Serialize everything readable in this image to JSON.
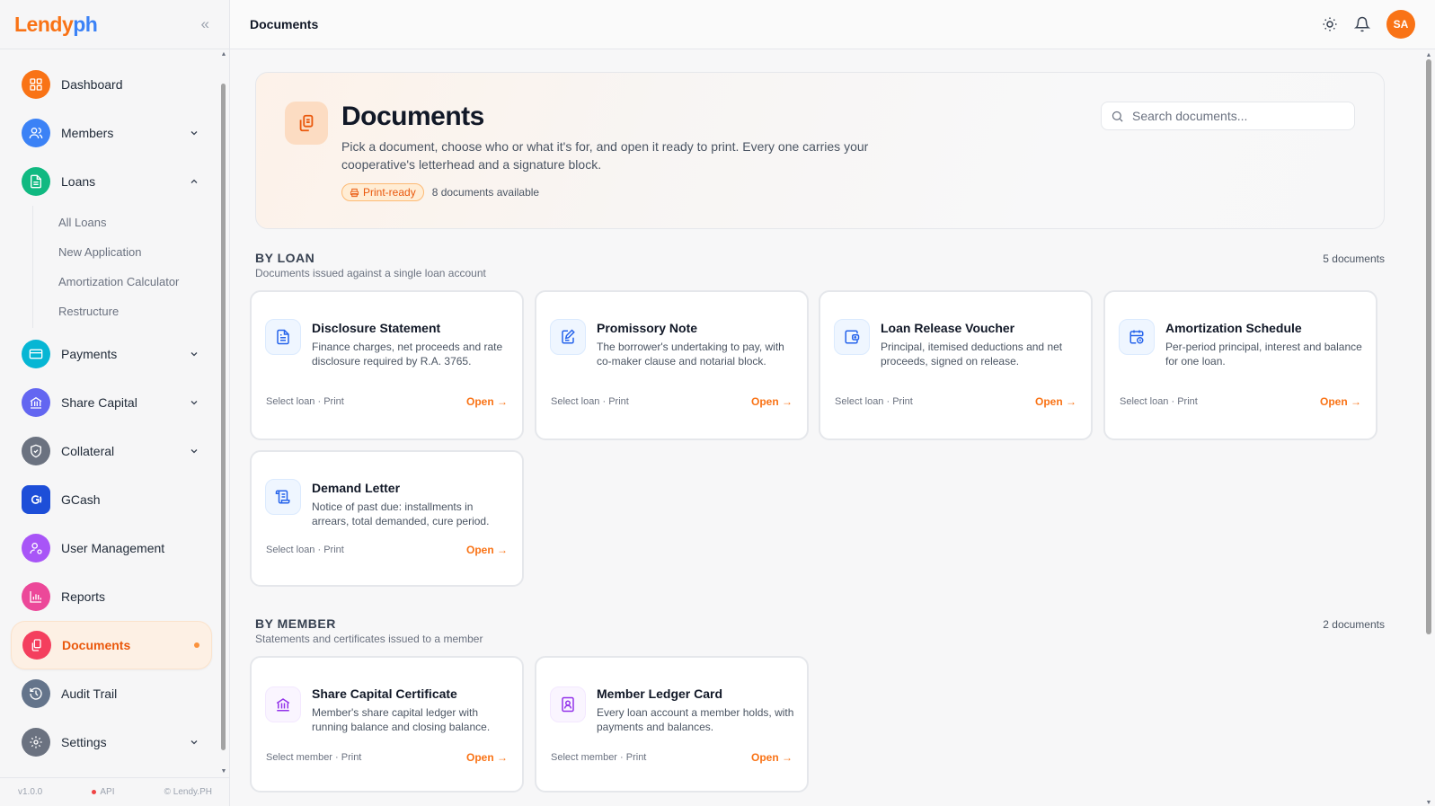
{
  "app": {
    "logo_part1": "Lendy",
    "logo_part2": "ph",
    "version": "v1.0.0",
    "api_label": "API",
    "copyright": "© Lendy.PH"
  },
  "sidebar": {
    "items": {
      "dashboard": {
        "label": "Dashboard",
        "color": "#f97316"
      },
      "members": {
        "label": "Members",
        "color": "#3b82f6"
      },
      "loans": {
        "label": "Loans",
        "color": "#10b981"
      },
      "payments": {
        "label": "Payments",
        "color": "#06b6d4"
      },
      "share_capital": {
        "label": "Share Capital",
        "color": "#6366f1"
      },
      "collateral": {
        "label": "Collateral",
        "color": "#6b7280"
      },
      "gcash": {
        "label": "GCash",
        "color": "#1d4ed8"
      },
      "user_management": {
        "label": "User Management",
        "color": "#a855f7"
      },
      "reports": {
        "label": "Reports",
        "color": "#ec4899"
      },
      "documents": {
        "label": "Documents",
        "color": "#f43f5e"
      },
      "audit_trail": {
        "label": "Audit Trail",
        "color": "#64748b"
      },
      "settings": {
        "label": "Settings",
        "color": "#6b7280"
      }
    },
    "loans_sub": [
      "All Loans",
      "New Application",
      "Amortization Calculator",
      "Restructure"
    ]
  },
  "topbar": {
    "title": "Documents",
    "avatar_initials": "SA"
  },
  "hero": {
    "title": "Documents",
    "description": "Pick a document, choose who or what it's for, and open it ready to print. Every one carries your cooperative's letterhead and a signature block.",
    "badge": "Print-ready",
    "count_text": "8 documents available",
    "search_placeholder": "Search documents..."
  },
  "sections": {
    "by_loan": {
      "title": "BY LOAN",
      "subtitle": "Documents issued against a single loan account",
      "count": "5 documents",
      "cards": [
        {
          "title": "Disclosure Statement",
          "desc": "Finance charges, net proceeds and rate disclosure required by R.A. 3765.",
          "meta": "Select loan · Print",
          "action": "Open →",
          "icon": "document-icon"
        },
        {
          "title": "Promissory Note",
          "desc": "The borrower's undertaking to pay, with co-maker clause and notarial block.",
          "meta": "Select loan · Print",
          "action": "Open →",
          "icon": "pen-document-icon"
        },
        {
          "title": "Loan Release Voucher",
          "desc": "Principal, itemised deductions and net proceeds, signed on release.",
          "meta": "Select loan · Print",
          "action": "Open →",
          "icon": "wallet-icon"
        },
        {
          "title": "Amortization Schedule",
          "desc": "Per-period principal, interest and balance for one loan.",
          "meta": "Select loan · Print",
          "action": "Open →",
          "icon": "calendar-clock-icon"
        },
        {
          "title": "Demand Letter",
          "desc": "Notice of past due: installments in arrears, total demanded, cure period.",
          "meta": "Select loan · Print",
          "action": "Open →",
          "icon": "scroll-icon"
        }
      ]
    },
    "by_member": {
      "title": "BY MEMBER",
      "subtitle": "Statements and certificates issued to a member",
      "count": "2 documents",
      "cards": [
        {
          "title": "Share Capital Certificate",
          "desc": "Member's share capital ledger with running balance and closing balance.",
          "meta": "Select member · Print",
          "action": "Open →",
          "icon": "bank-icon"
        },
        {
          "title": "Member Ledger Card",
          "desc": "Every loan account a member holds, with payments and balances.",
          "meta": "Select member · Print",
          "action": "Open →",
          "icon": "contact-book-icon"
        }
      ]
    }
  }
}
